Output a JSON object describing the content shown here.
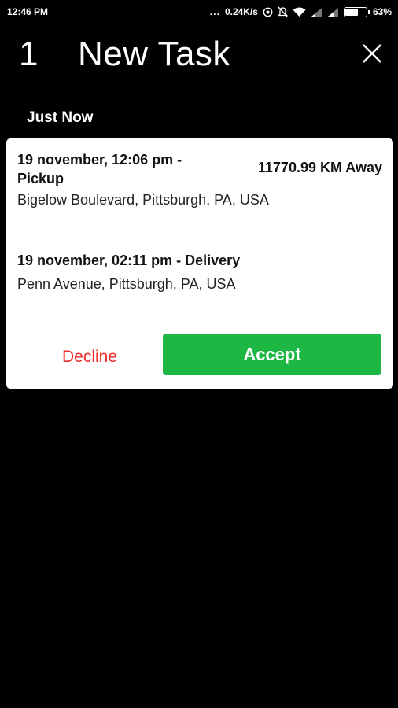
{
  "status_bar": {
    "time": "12:46 PM",
    "dots": "...",
    "network_speed": "0.24K/s",
    "battery_percent": "63%",
    "battery_level": 0.63
  },
  "header": {
    "task_count": "1",
    "title": "New Task"
  },
  "time_label": "Just Now",
  "task": {
    "pickup_title": "19 november, 12:06 pm - Pickup",
    "distance": "11770.99 KM Away",
    "pickup_address": "Bigelow Boulevard, Pittsburgh, PA, USA",
    "delivery_title": "19 november, 02:11 pm - Delivery",
    "delivery_address": "Penn Avenue, Pittsburgh, PA, USA"
  },
  "actions": {
    "decline_label": "Decline",
    "accept_label": "Accept"
  },
  "colors": {
    "background": "#000000",
    "card": "#ffffff",
    "accept": "#1cb843",
    "decline": "#ee2b2b"
  }
}
